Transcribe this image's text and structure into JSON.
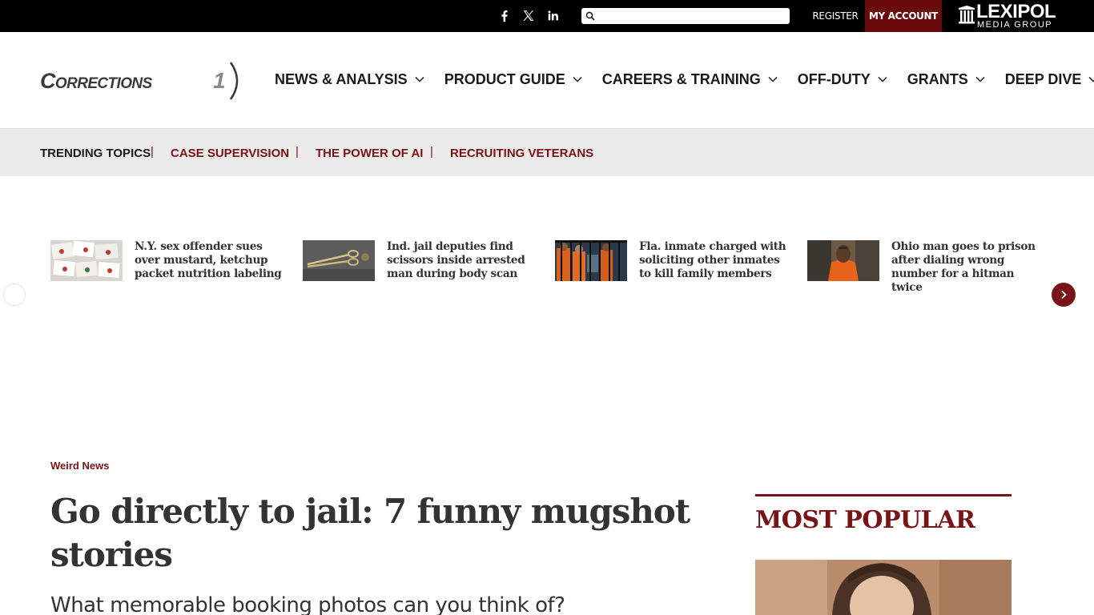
{
  "topbar": {
    "social": [
      {
        "name": "facebook-icon"
      },
      {
        "name": "x-icon"
      },
      {
        "name": "linkedin-icon"
      }
    ],
    "search": {
      "placeholder": "",
      "value": ""
    },
    "register_label": "REGISTER",
    "my_account_label": "MY ACCOUNT",
    "brand": {
      "name": "LEXIPOL",
      "sub": "MEDIA GROUP"
    }
  },
  "header": {
    "logo": {
      "text": "Corrections",
      "number": "1"
    },
    "nav": [
      {
        "label": "NEWS & ANALYSIS"
      },
      {
        "label": "PRODUCT GUIDE"
      },
      {
        "label": "CAREERS & TRAINING"
      },
      {
        "label": "OFF-DUTY"
      },
      {
        "label": "GRANTS"
      },
      {
        "label": "DEEP DIVE"
      }
    ]
  },
  "trending": {
    "label": "TRENDING TOPICS",
    "links": [
      {
        "label": "CASE SUPERVISION"
      },
      {
        "label": "THE POWER OF AI"
      },
      {
        "label": "RECRUITING VETERANS"
      }
    ]
  },
  "carousel": {
    "cards": [
      {
        "headline": "N.Y. sex offender sues over mustard, ketchup packet nutrition labeling"
      },
      {
        "headline": "Ind. jail deputies find scissors inside arrested man during body scan"
      },
      {
        "headline": "Fla. inmate charged with soliciting other inmates to kill family members"
      },
      {
        "headline": "Ohio man goes to prison after dialing wrong number for a hitman twice"
      }
    ]
  },
  "article": {
    "category": "Weird News",
    "title": "Go directly to jail: 7 funny mugshot stories",
    "subtitle": "What memorable booking photos can you think of?"
  },
  "sidebar": {
    "popular_title": "MOST POPULAR"
  },
  "colors": {
    "brand_red": "#7a1316",
    "account_red": "#6b0a0d",
    "topbar_bg": "#000000",
    "trending_bg": "#ebebeb"
  }
}
